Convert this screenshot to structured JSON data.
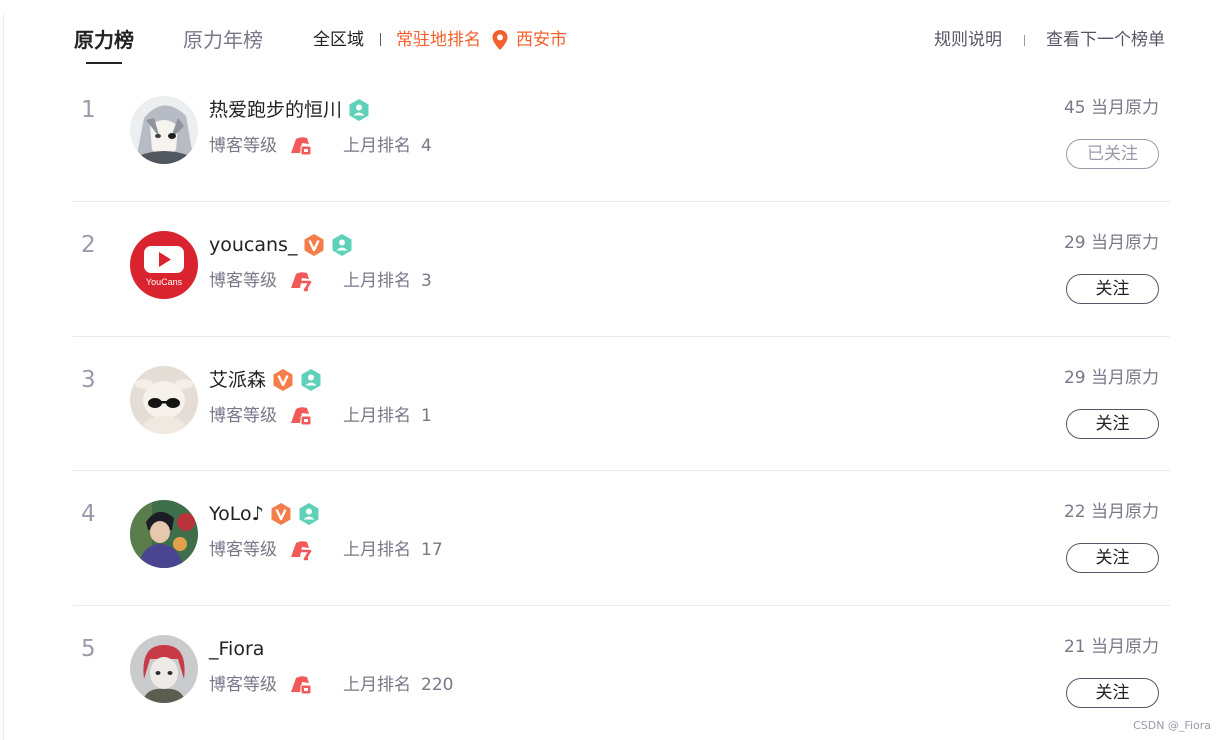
{
  "tabs": {
    "active": "原力榜",
    "year": "原力年榜"
  },
  "region": {
    "all": "全区域",
    "local": "常驻地排名",
    "city": "西安市"
  },
  "header_links": {
    "rules": "规则说明",
    "next": "查看下一个榜单"
  },
  "labels": {
    "blog_level": "博客等级",
    "last_month_rank": "上月排名"
  },
  "icons": {
    "location": "map-pin-icon",
    "verified": "verified-v-badge-icon",
    "fan": "fan-badge-icon",
    "level": "blog-level-icon"
  },
  "colors": {
    "accent": "#f4602c",
    "text_primary": "#222226",
    "text_secondary": "#777888",
    "rank_number": "#999aaa",
    "verified_badge": "#f47d4a",
    "fan_badge": "#5fd1b8"
  },
  "entries": [
    {
      "rank": "1",
      "name": "热爱跑步的恒川",
      "verified": false,
      "fan": true,
      "last_month_rank": "4",
      "power": "45 当月原力",
      "follow": "已关注",
      "followed": true
    },
    {
      "rank": "2",
      "name": "youcans_",
      "verified": true,
      "fan": true,
      "last_month_rank": "3",
      "power": "29 当月原力",
      "follow": "关注",
      "followed": false,
      "avatar_text": "YouCans"
    },
    {
      "rank": "3",
      "name": "艾派森",
      "verified": true,
      "fan": true,
      "last_month_rank": "1",
      "power": "29 当月原力",
      "follow": "关注",
      "followed": false
    },
    {
      "rank": "4",
      "name": "YoLo♪",
      "verified": true,
      "fan": true,
      "last_month_rank": "17",
      "power": "22 当月原力",
      "follow": "关注",
      "followed": false
    },
    {
      "rank": "5",
      "name": "_Fiora",
      "verified": false,
      "fan": false,
      "last_month_rank": "220",
      "power": "21 当月原力",
      "follow": "关注",
      "followed": false
    }
  ],
  "watermark": "CSDN @_Fiora"
}
